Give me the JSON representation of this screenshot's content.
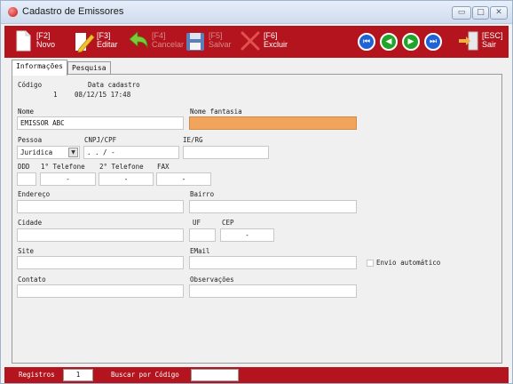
{
  "window": {
    "title": "Cadastro de Emissores",
    "controls": {
      "minimize": "▭",
      "maximize": "□",
      "close": "✕"
    }
  },
  "toolbar": {
    "novo": {
      "key": "[F2]",
      "label": "Novo",
      "icon": "document-new-icon"
    },
    "editar": {
      "key": "[F3]",
      "label": "Editar",
      "icon": "pencil-icon"
    },
    "cancelar": {
      "key": "[F4]",
      "label": "Cancelar",
      "icon": "undo-arrow-icon"
    },
    "salvar": {
      "key": "[F5]",
      "label": "Salvar",
      "icon": "floppy-disk-icon"
    },
    "excluir": {
      "key": "[F6]",
      "label": "Excluir",
      "icon": "scissors-icon"
    },
    "sair": {
      "key": "[ESC]",
      "label": "Sair",
      "icon": "exit-door-icon"
    },
    "nav": {
      "first": "⏮",
      "prev": "◀",
      "next": "▶",
      "last": "⏭"
    },
    "colors": {
      "bar": "#b3141d",
      "nav_blue": "#1f62d6",
      "nav_green": "#20a52a"
    }
  },
  "tabs": {
    "informacoes": "Informações",
    "pesquisa": "Pesquisa"
  },
  "form": {
    "codigo": {
      "label": "Código",
      "value": "1"
    },
    "data_cadastro": {
      "label": "Data cadastro",
      "value": "08/12/15 17:48"
    },
    "nome": {
      "label": "Nome",
      "value": "EMISSOR ABC"
    },
    "nome_fantasia": {
      "label": "Nome fantasia",
      "value": "",
      "highlight": "#f0a45c"
    },
    "pessoa": {
      "label": "Pessoa",
      "value": "Juridica"
    },
    "cnpj_cpf": {
      "label": "CNPJ/CPF",
      "mask": " .   .   /   -"
    },
    "ie_rg": {
      "label": "IE/RG",
      "value": ""
    },
    "ddd": {
      "label": "DDD",
      "value": ""
    },
    "telefone1": {
      "label": "1° Telefone",
      "mask": "-"
    },
    "telefone2": {
      "label": "2° Telefone",
      "mask": "-"
    },
    "fax": {
      "label": "FAX",
      "mask": "-"
    },
    "endereco": {
      "label": "Endereço",
      "value": ""
    },
    "bairro": {
      "label": "Bairro",
      "value": ""
    },
    "cidade": {
      "label": "Cidade",
      "value": ""
    },
    "uf": {
      "label": "UF",
      "value": ""
    },
    "cep": {
      "label": "CEP",
      "mask": "-"
    },
    "site": {
      "label": "Site",
      "value": ""
    },
    "email": {
      "label": "EMail",
      "value": ""
    },
    "envio_automatico": {
      "label": "Envio automático",
      "checked": false
    },
    "contato": {
      "label": "Contato",
      "value": ""
    },
    "observacoes": {
      "label": "Observações",
      "value": ""
    }
  },
  "statusbar": {
    "registros_label": "Registros",
    "registros_value": "1",
    "buscar_label": "Buscar por Código",
    "buscar_value": ""
  }
}
